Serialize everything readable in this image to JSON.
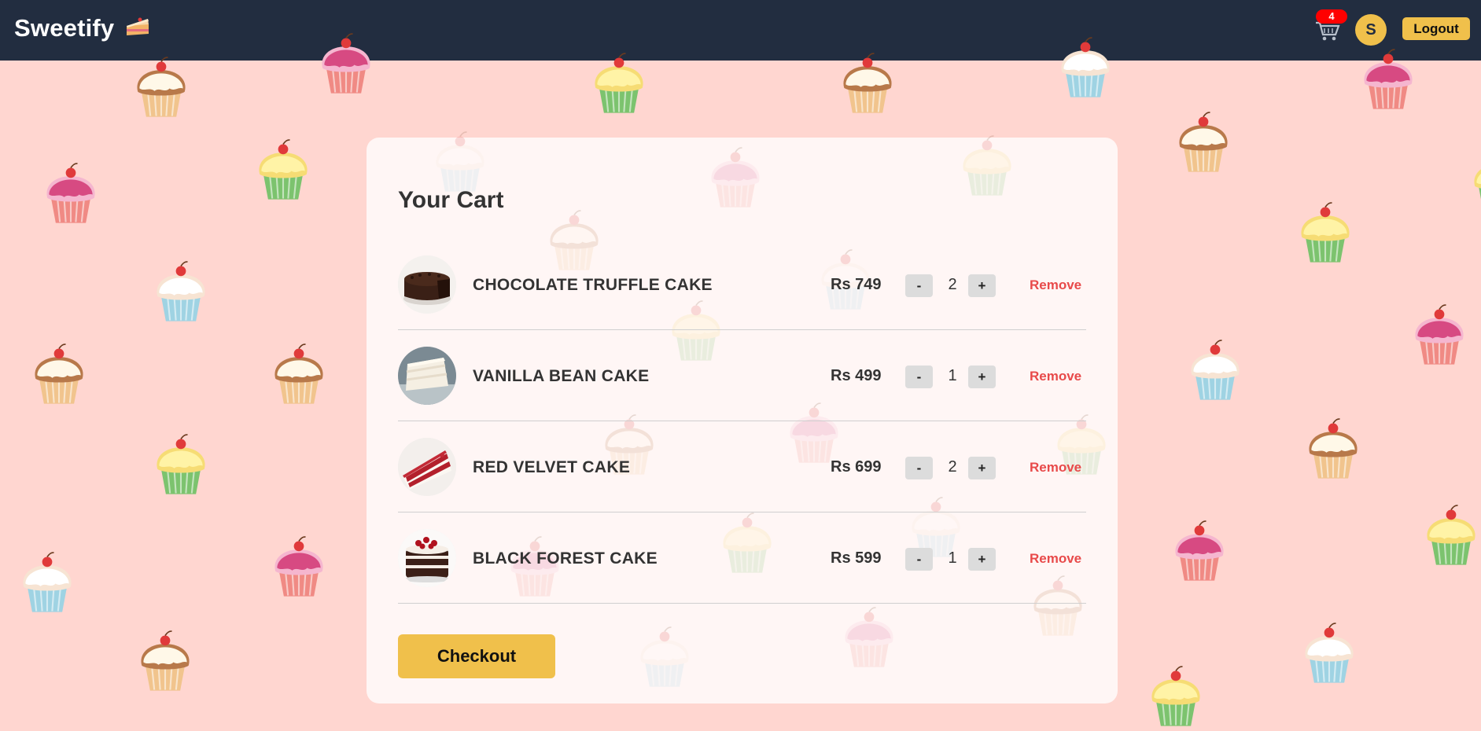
{
  "header": {
    "brand": "Sweetify",
    "cart_count": "4",
    "avatar_initial": "S",
    "logout_label": "Logout"
  },
  "cart": {
    "title": "Your Cart",
    "items": [
      {
        "name": "CHOCOLATE TRUFFLE CAKE",
        "price": "Rs 749",
        "qty": "2",
        "minus": "-",
        "plus": "+",
        "remove": "Remove"
      },
      {
        "name": "VANILLA BEAN CAKE",
        "price": "Rs 499",
        "qty": "1",
        "minus": "-",
        "plus": "+",
        "remove": "Remove"
      },
      {
        "name": "RED VELVET CAKE",
        "price": "Rs 699",
        "qty": "2",
        "minus": "-",
        "plus": "+",
        "remove": "Remove"
      },
      {
        "name": "BLACK FOREST CAKE",
        "price": "Rs 599",
        "qty": "1",
        "minus": "-",
        "plus": "+",
        "remove": "Remove"
      }
    ],
    "checkout_label": "Checkout"
  },
  "colors": {
    "header_bg": "#222d40",
    "page_bg": "#ffd6d0",
    "accent": "#f0c04b",
    "remove": "#e84a4a",
    "badge": "#ff0000"
  },
  "icons": [
    "cake-slice-icon",
    "cart-icon",
    "cupcake-pattern"
  ]
}
